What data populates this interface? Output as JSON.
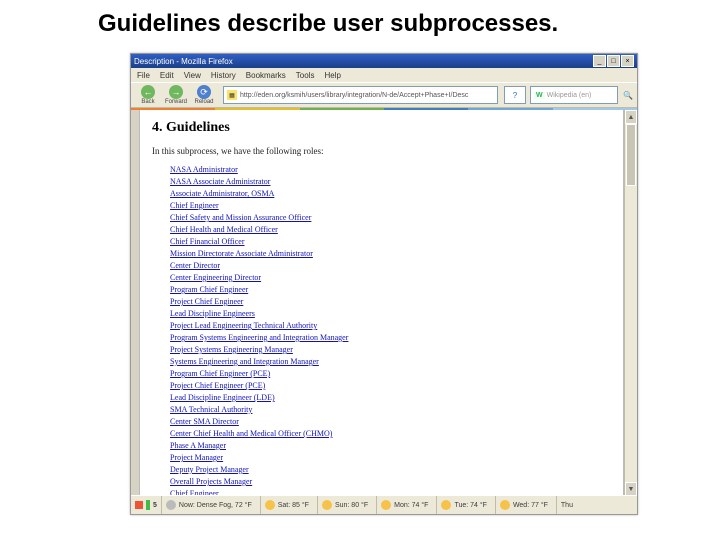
{
  "slide": {
    "heading": "Guidelines describe user subprocesses."
  },
  "window": {
    "title": "Description - Mozilla Firefox",
    "buttons": {
      "min": "_",
      "max": "□",
      "close": "×"
    }
  },
  "menubar": [
    "File",
    "Edit",
    "View",
    "History",
    "Bookmarks",
    "Tools",
    "Help"
  ],
  "toolbar": {
    "back": "Back",
    "fwd": "Forward",
    "reload": "Reload",
    "address": "http://eden.org/ksmih/users/library/integration/N-de/Accept+Phase+I/Desc",
    "search_label": "W",
    "search_placeholder": "Wikipedia (en)"
  },
  "accent": [
    "#f08030",
    "#e0c030",
    "#70b050",
    "#407fbf",
    "#6fa8d8",
    "#a0c8e8"
  ],
  "document": {
    "heading": "4. Guidelines",
    "intro": "In this subprocess, we have the following roles:",
    "roles": [
      "NASA Administrator",
      "NASA Associate Administrator",
      "Associate Administrator, OSMA",
      "Chief Engineer",
      "Chief Safety and Mission Assurance Officer",
      "Chief Health and Medical Officer",
      "Chief Financial Officer",
      "Mission Directorate Associate Administrator",
      "Center Director",
      "Center Engineering Director",
      "Program Chief Engineer",
      "Project Chief Engineer",
      "Lead Discipline Engineers",
      "Project Lead Engineering Technical Authority",
      "Program Systems Engineering and Integration Manager",
      "Project Systems Engineering Manager",
      "Systems Engineering and Integration Manager",
      "Program Chief Engineer (PCE)",
      "Project Chief Engineer (PCE)",
      "Lead Discipline Engineer (LDE)",
      "SMA Technical Authority",
      "Center SMA Director",
      "Center Chief Health and Medical Officer (CHMO)",
      "Phase A Manager",
      "Project Manager",
      "Deputy Project Manager",
      "Overall Projects Manager",
      "Chief Engineer"
    ]
  },
  "taskbar": {
    "weather_now": "Now: Dense Fog, 72 °F",
    "days": [
      {
        "label": "Sat: 85 °F"
      },
      {
        "label": "Sun: 80 °F"
      },
      {
        "label": "Mon: 74 °F"
      },
      {
        "label": "Tue: 74 °F"
      },
      {
        "label": "Wed: 77 °F"
      },
      {
        "label": "Thu"
      }
    ]
  }
}
